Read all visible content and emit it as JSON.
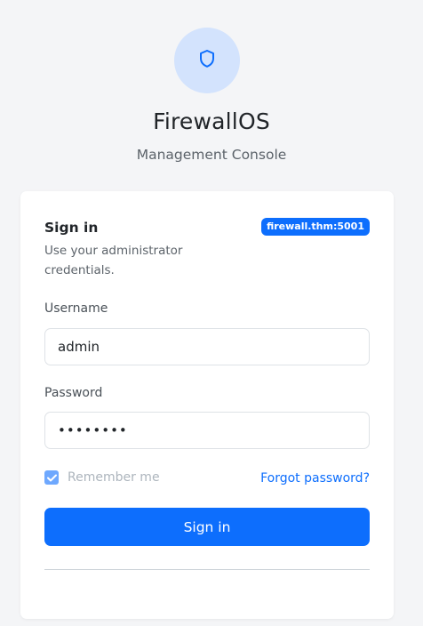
{
  "app": {
    "name": "FirewallOS",
    "subtitle": "Management Console",
    "logo_icon": "shield-icon"
  },
  "login_card": {
    "title": "Sign in",
    "host_badge": "firewall.thm:5001",
    "description": "Use your administrator credentials.",
    "username": {
      "label": "Username",
      "value": "admin"
    },
    "password": {
      "label": "Password",
      "value": "••••••••"
    },
    "remember_me": {
      "label": "Remember me",
      "checked": true
    },
    "forgot_link": "Forgot password?",
    "submit_label": "Sign in"
  },
  "colors": {
    "accent": "#0d6efd",
    "logo_bg": "#d3e3fd",
    "page_bg": "#f4f5f7",
    "checkbox": "#6ea8fe"
  }
}
